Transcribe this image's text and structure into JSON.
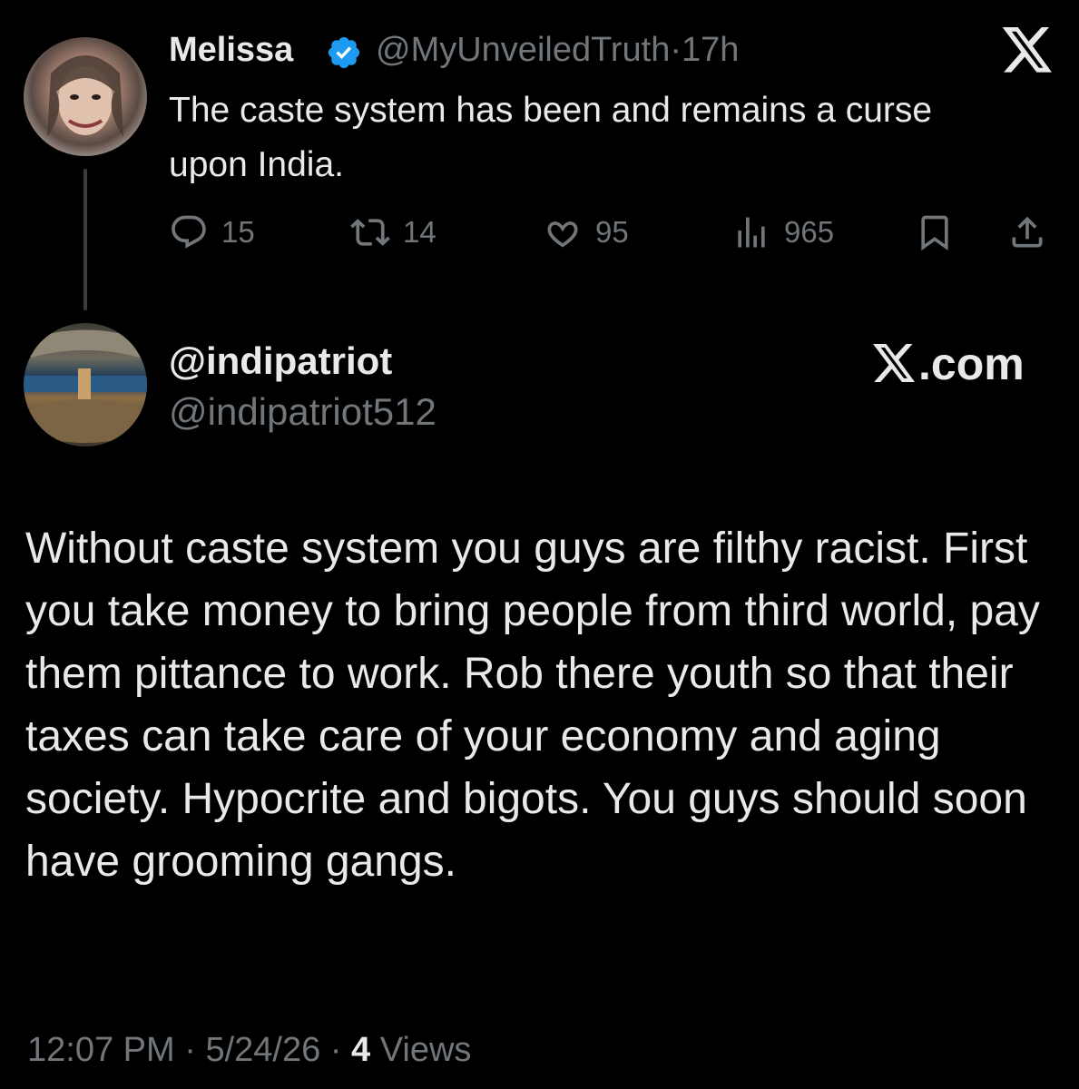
{
  "tweet1": {
    "name": "Melissa",
    "handle": "@MyUnveiledTruth",
    "separator": "·",
    "time": "17h",
    "text": "The caste system has been and remains a curse upon India.",
    "actions": {
      "replies": "15",
      "reposts": "14",
      "likes": "95",
      "views": "965"
    }
  },
  "tweet2": {
    "display_name": "@indipatriot",
    "handle": "@indipatriot512",
    "brand": ".com",
    "text": "Without caste system you guys are filthy racist. First you take money to bring people from third world, pay them pittance to work. Rob there youth so that their taxes can take care of your economy and aging society. Hypocrite and bigots. You guys should soon have grooming gangs.",
    "footer": {
      "time": "12:07 PM",
      "sep1": " · ",
      "date": "5/24/26",
      "sep2": " · ",
      "views_count": "4",
      "views_label": " Views"
    }
  },
  "icons": {
    "verified": "verified-badge-icon",
    "x_logo": "x-logo-icon",
    "reply": "reply-icon",
    "repost": "repost-icon",
    "like": "heart-icon",
    "views": "analytics-icon",
    "bookmark": "bookmark-icon",
    "share": "share-icon"
  },
  "colors": {
    "background": "#000000",
    "text": "#e7e9ea",
    "secondary": "#71767b",
    "verified": "#1d9bf0"
  }
}
